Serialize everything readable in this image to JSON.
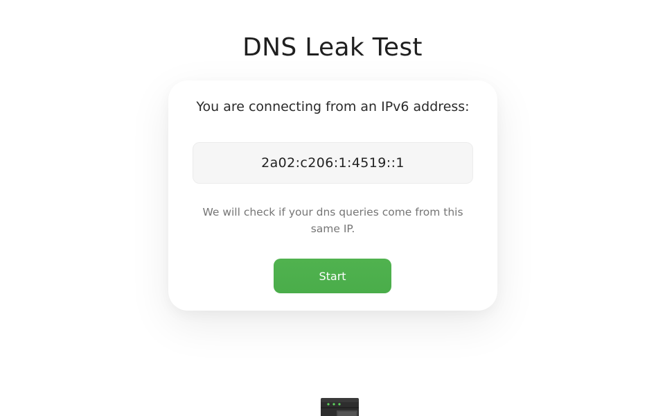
{
  "page": {
    "title": "DNS Leak Test"
  },
  "card": {
    "heading": "You are connecting from an IPv6 address:",
    "ip_address": "2a02:c206:1:4519::1",
    "note": "We will check if your dns queries come from this same IP.",
    "start_label": "Start"
  },
  "illustration": {
    "icon": "server-icon"
  },
  "colors": {
    "accent": "#4caf50",
    "background": "#ffffff",
    "ip_box_bg": "#f6f6f6",
    "note_text": "#757575"
  }
}
